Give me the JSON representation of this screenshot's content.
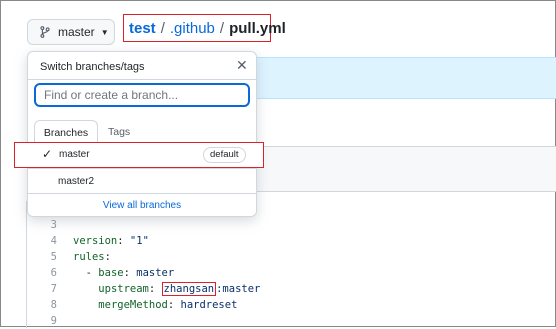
{
  "header": {
    "branch_button_label": "master",
    "breadcrumb": {
      "repo": "test",
      "sep1": "/",
      "dir": ".github",
      "sep2": "/",
      "file": "pull.yml"
    }
  },
  "dropdown": {
    "title": "Switch branches/tags",
    "close_icon": "✕",
    "input_placeholder": "Find or create a branch...",
    "tabs": [
      "Branches",
      "Tags"
    ],
    "branches": [
      {
        "name": "master",
        "badge": "default",
        "selected": true
      },
      {
        "name": "master2"
      }
    ],
    "view_all": "View all branches"
  },
  "code": {
    "lines": [
      {
        "n": "3"
      },
      {
        "n": "4",
        "key": "version",
        "colon": ": ",
        "val": "\"1\""
      },
      {
        "n": "5",
        "key": "rules",
        "colon": ":"
      },
      {
        "n": "6",
        "indent": "  - ",
        "key": "base",
        "colon": ": ",
        "val": "master"
      },
      {
        "n": "7",
        "indent": "    ",
        "key": "upstream",
        "colon": ": ",
        "hl": "zhangsan",
        "rest": ":master"
      },
      {
        "n": "8",
        "indent": "    ",
        "key": "mergeMethod",
        "colon": ": ",
        "val": "hardreset"
      },
      {
        "n": "9"
      }
    ]
  },
  "colors": {
    "accent": "#0969da",
    "highlight_border": "#d9222a"
  }
}
